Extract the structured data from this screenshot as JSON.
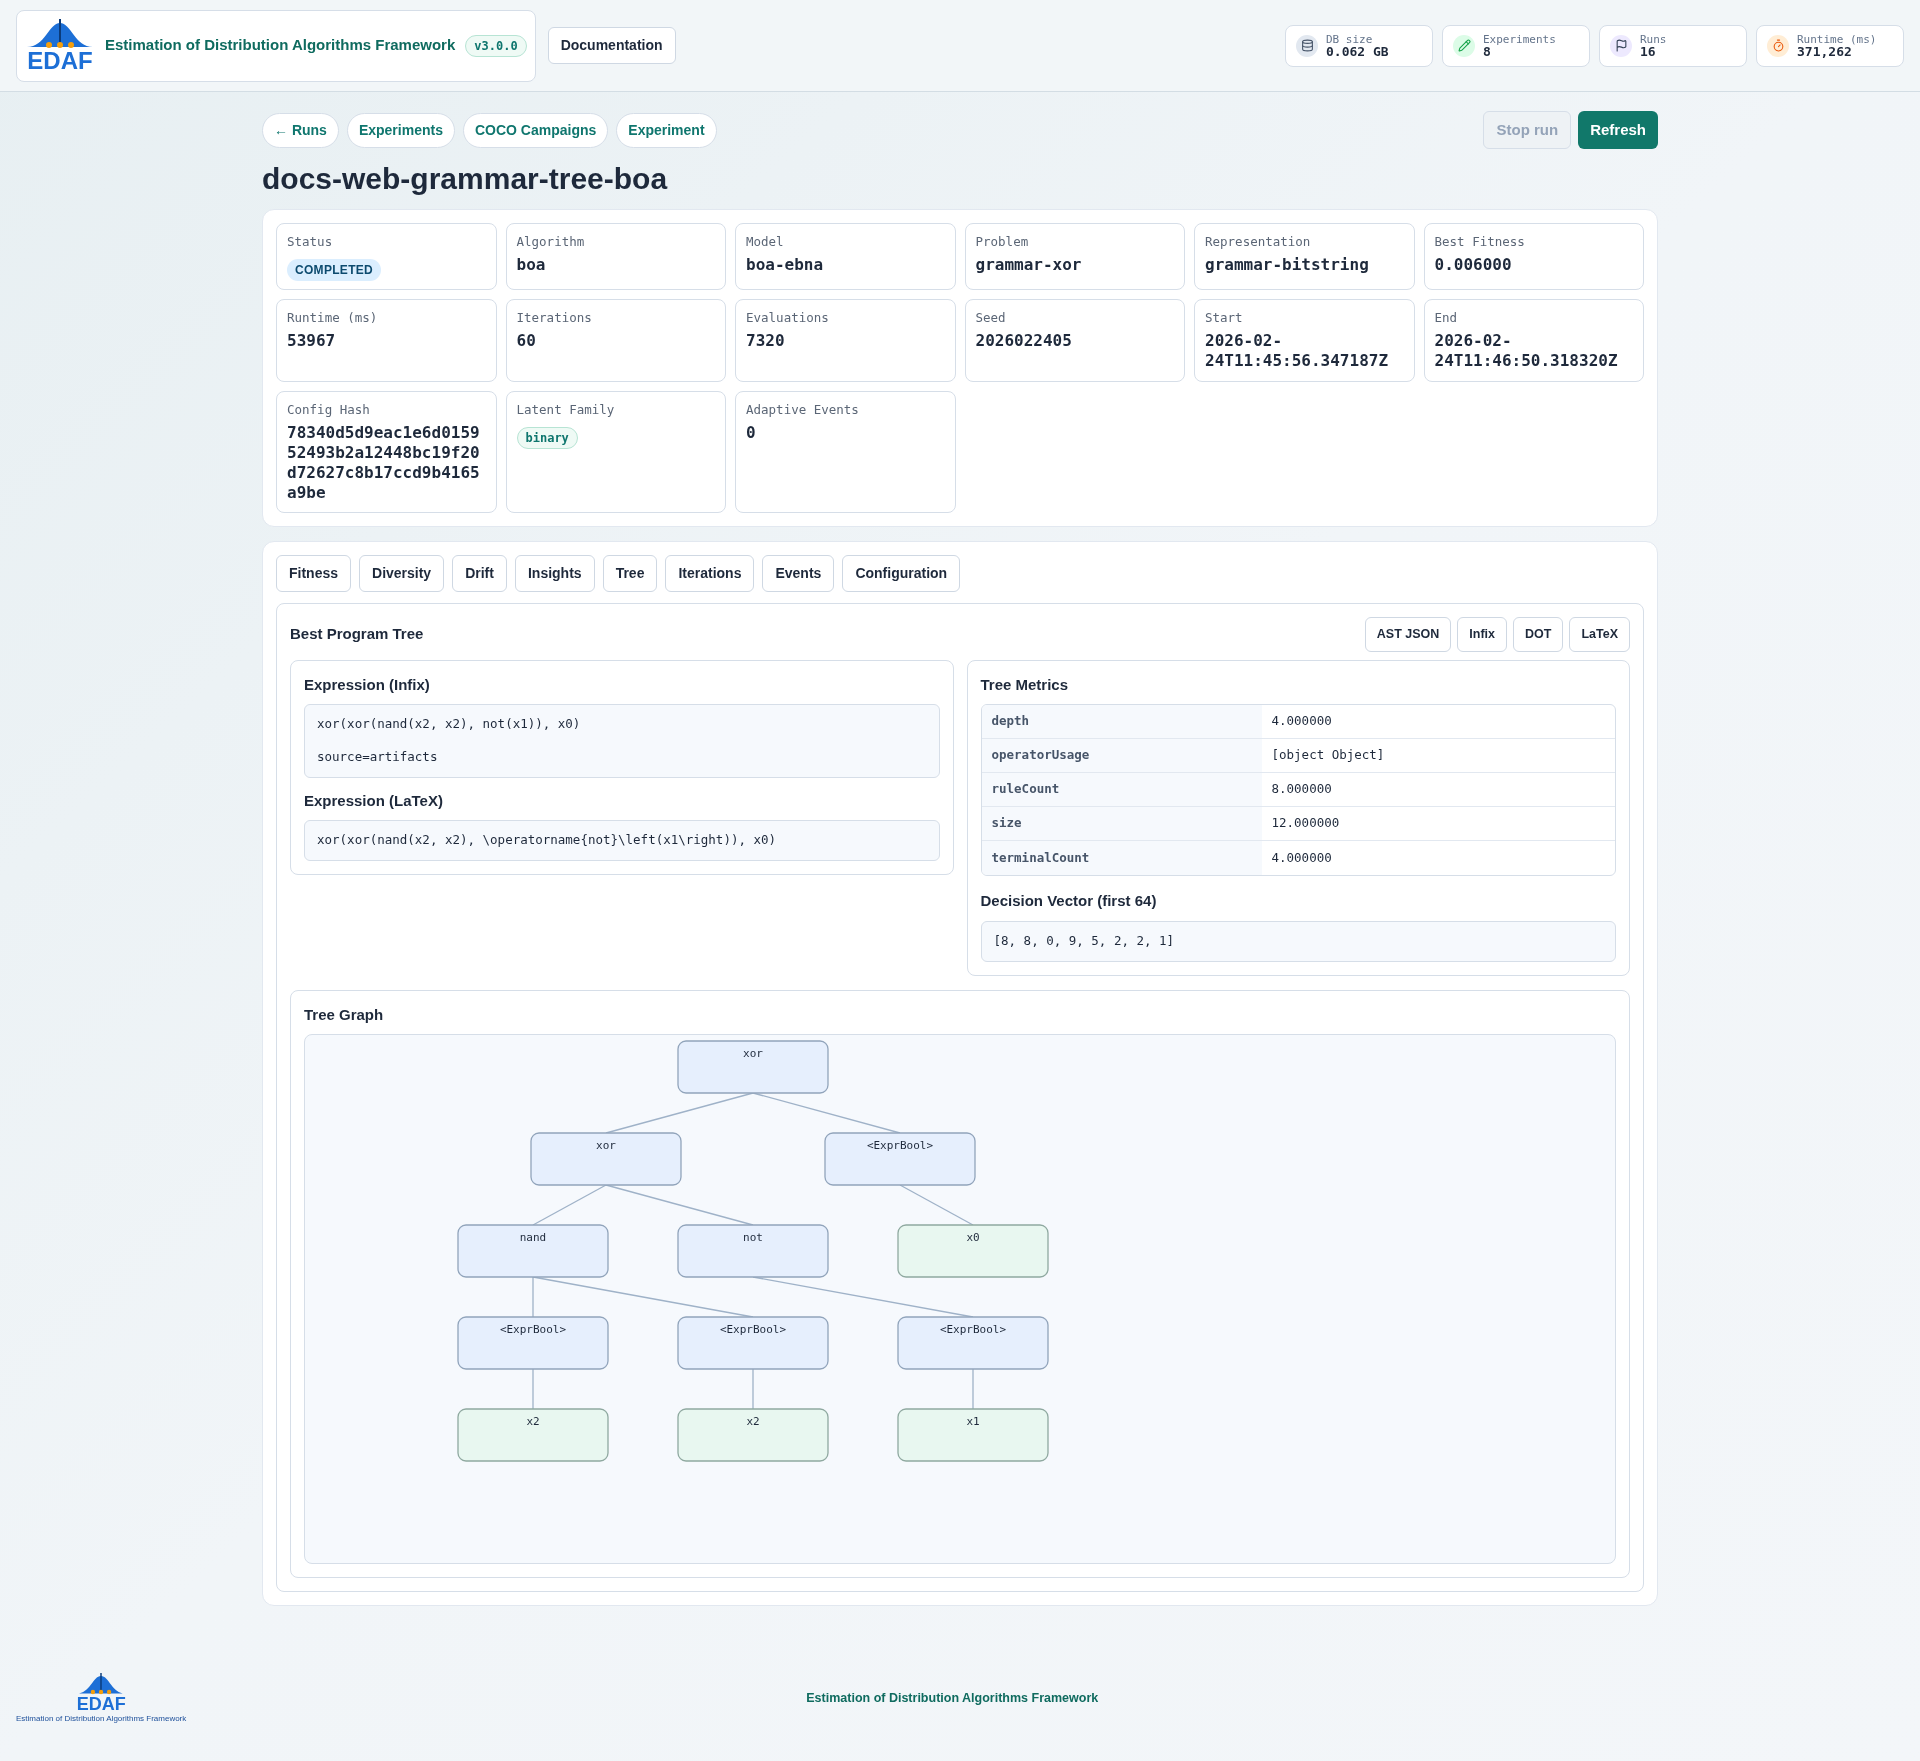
{
  "header": {
    "logo_text": "EDAF",
    "title": "Estimation of Distribution Algorithms Framework",
    "version": "v3.0.0",
    "doc_button": "Documentation",
    "stats": [
      {
        "kind": "database",
        "label": "DB size",
        "value": "0.062 GB"
      },
      {
        "kind": "experiments",
        "label": "Experiments",
        "value": "8"
      },
      {
        "kind": "runs",
        "label": "Runs",
        "value": "16"
      },
      {
        "kind": "runtime",
        "label": "Runtime (ms)",
        "value": "371,262"
      }
    ]
  },
  "nav": {
    "links": [
      "← Runs",
      "Experiments",
      "COCO Campaigns",
      "Experiment"
    ],
    "actions": [
      {
        "label": "Stop run",
        "kind": "secondary",
        "disabled": true
      },
      {
        "label": "Refresh",
        "kind": "primary",
        "disabled": false
      }
    ]
  },
  "run_title": "docs-web-grammar-tree-boa",
  "fields": [
    {
      "label": "Status",
      "value": "COMPLETED",
      "kind": "status"
    },
    {
      "label": "Algorithm",
      "value": "boa",
      "kind": "text"
    },
    {
      "label": "Model",
      "value": "boa-ebna",
      "kind": "text"
    },
    {
      "label": "Problem",
      "value": "grammar-xor",
      "kind": "text"
    },
    {
      "label": "Representation",
      "value": "grammar-bitstring",
      "kind": "text"
    },
    {
      "label": "Best Fitness",
      "value": "0.006000",
      "kind": "text"
    },
    {
      "label": "Runtime (ms)",
      "value": "53967",
      "kind": "text"
    },
    {
      "label": "Iterations",
      "value": "60",
      "kind": "text"
    },
    {
      "label": "Evaluations",
      "value": "7320",
      "kind": "text"
    },
    {
      "label": "Seed",
      "value": "2026022405",
      "kind": "text"
    },
    {
      "label": "Start",
      "value": "2026-02-24T11:45:56.347187Z",
      "kind": "text"
    },
    {
      "label": "End",
      "value": "2026-02-24T11:46:50.318320Z",
      "kind": "text"
    },
    {
      "label": "Config Hash",
      "value": "78340d5d9eac1e6d015952493b2a12448bc19f20d72627c8b17ccd9b4165a9be",
      "kind": "text"
    },
    {
      "label": "Latent Family",
      "value": "binary",
      "kind": "tag"
    },
    {
      "label": "Adaptive Events",
      "value": "0",
      "kind": "text"
    }
  ],
  "tabs": [
    "Fitness",
    "Diversity",
    "Drift",
    "Insights",
    "Tree",
    "Iterations",
    "Events",
    "Configuration"
  ],
  "tree_panel": {
    "title": "Best Program Tree",
    "formats": [
      "AST JSON",
      "Infix",
      "DOT",
      "LaTeX"
    ],
    "infix": {
      "title": "Expression (Infix)",
      "expression": "xor(xor(nand(x2, x2), not(x1)), x0)",
      "source": "source=artifacts"
    },
    "latex": {
      "title": "Expression (LaTeX)",
      "expression": "xor(xor(nand(x2, x2), \\operatorname{not}\\left(x1\\right)), x0)"
    },
    "metrics": {
      "title": "Tree Metrics",
      "rows": [
        {
          "name": "depth",
          "value": "4.000000"
        },
        {
          "name": "operatorUsage",
          "value": "[object Object]"
        },
        {
          "name": "ruleCount",
          "value": "8.000000"
        },
        {
          "name": "size",
          "value": "12.000000"
        },
        {
          "name": "terminalCount",
          "value": "4.000000"
        }
      ]
    },
    "decision_vector": {
      "title": "Decision Vector (first 64)",
      "value": "[8, 8, 0, 9, 5, 2, 2, 1]"
    },
    "graph": {
      "title": "Tree Graph",
      "root": {
        "label": "xor",
        "kind": "operator",
        "children": [
          {
            "label": "xor",
            "kind": "operator",
            "children": [
              {
                "label": "nand",
                "kind": "operator",
                "children": [
                  {
                    "label": "<ExprBool>",
                    "kind": "operator",
                    "children": [
                      {
                        "label": "x2",
                        "kind": "terminal"
                      }
                    ]
                  },
                  {
                    "label": "<ExprBool>",
                    "kind": "operator",
                    "children": [
                      {
                        "label": "x2",
                        "kind": "terminal"
                      }
                    ]
                  }
                ]
              },
              {
                "label": "not",
                "kind": "operator",
                "children": [
                  {
                    "label": "<ExprBool>",
                    "kind": "operator",
                    "children": [
                      {
                        "label": "x1",
                        "kind": "terminal"
                      }
                    ]
                  }
                ]
              }
            ]
          },
          {
            "label": "<ExprBool>",
            "kind": "operator",
            "children": [
              {
                "label": "x0",
                "kind": "terminal"
              }
            ]
          }
        ]
      }
    }
  },
  "footer": {
    "logo_text": "EDAF",
    "logo_caption": "Estimation of Distribution Algorithms Framework",
    "text": "Estimation of Distribution Algorithms Framework"
  }
}
